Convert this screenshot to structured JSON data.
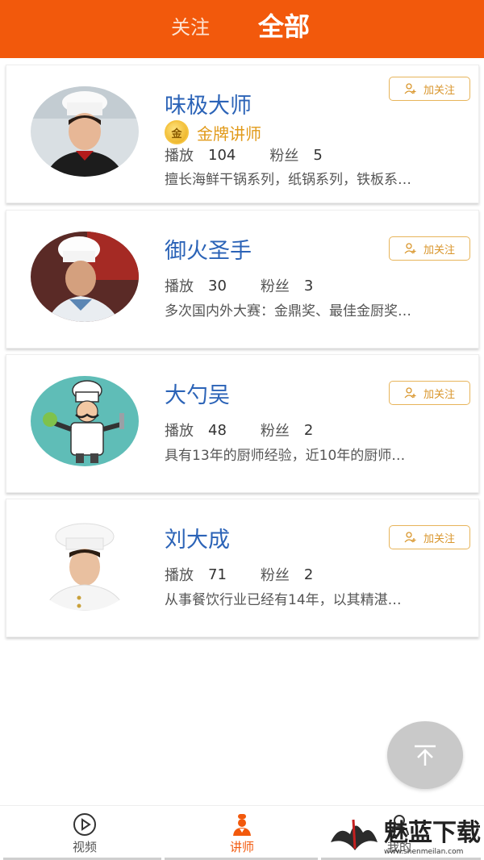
{
  "header": {
    "tab_follow": "关注",
    "tab_all": "全部"
  },
  "follow_label": "加关注",
  "badge_icon_char": "金",
  "stat_labels": {
    "play": "播放",
    "fans": "粉丝"
  },
  "teachers": [
    {
      "name": "味极大师",
      "badge": "金牌讲师",
      "plays": "104",
      "fans": "5",
      "desc": "擅长海鲜干锅系列，纸锅系列，铁板系…"
    },
    {
      "name": "御火圣手",
      "plays": "30",
      "fans": "3",
      "desc": "多次国内外大赛：金鼎奖、最佳金厨奖…"
    },
    {
      "name": "大勺吴",
      "plays": "48",
      "fans": "2",
      "desc": "具有13年的厨师经验，近10年的厨师…"
    },
    {
      "name": "刘大成",
      "plays": "71",
      "fans": "2",
      "desc": "从事餐饮行业已经有14年，以其精湛…"
    }
  ],
  "nav": {
    "video": "视频",
    "teacher": "讲师",
    "mine": "我的"
  },
  "watermark": {
    "brand": "魅蓝下载",
    "url": "www.shenmeilan.com"
  },
  "colors": {
    "header": "#f2590c",
    "name": "#2b63b7",
    "accent": "#e19a1a"
  }
}
